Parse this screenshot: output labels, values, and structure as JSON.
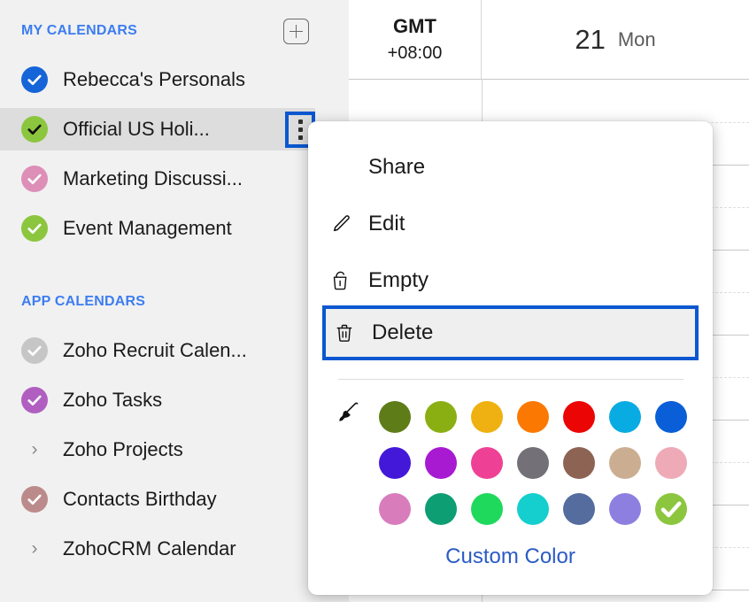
{
  "sidebar": {
    "sections": [
      {
        "title": "MY CALENDARS",
        "add_button": "+",
        "items": [
          {
            "label": "Rebecca's Personals",
            "color": "#1565d8",
            "checked": true,
            "type": "check"
          },
          {
            "label": "Official US Holi...",
            "color": "#8cc63e",
            "checked": true,
            "type": "check",
            "selected": true,
            "dark_check": true
          },
          {
            "label": "Marketing Discussi...",
            "color": "#dd8fb8",
            "checked": true,
            "type": "check"
          },
          {
            "label": "Event Management",
            "color": "#8cc63e",
            "checked": true,
            "type": "check"
          }
        ]
      },
      {
        "title": "APP CALENDARS",
        "items": [
          {
            "label": "Zoho Recruit Calen...",
            "color": "#c6c6c6",
            "checked": true,
            "type": "check"
          },
          {
            "label": "Zoho Tasks",
            "color": "#b05fc0",
            "checked": true,
            "type": "check"
          },
          {
            "label": "Zoho Projects",
            "type": "chevron",
            "chevron": "›"
          },
          {
            "label": "Contacts Birthday",
            "color": "#bb8b8b",
            "checked": true,
            "type": "check"
          },
          {
            "label": "ZohoCRM Calendar",
            "type": "chevron",
            "chevron": "›"
          }
        ]
      }
    ]
  },
  "calendar": {
    "timezone_name": "GMT",
    "timezone_offset": "+08:00",
    "day_number": "21",
    "day_name": "Mon"
  },
  "popup": {
    "menu": [
      {
        "label": "Share",
        "icon": "none"
      },
      {
        "label": "Edit",
        "icon": "pencil-icon"
      },
      {
        "label": "Empty",
        "icon": "trash-open-icon"
      },
      {
        "label": "Delete",
        "icon": "trash-icon",
        "highlighted": true
      }
    ],
    "palette_icon": "paintbrush-icon",
    "colors": [
      [
        "#5e7d18",
        "#8aaf12",
        "#eeb111",
        "#fb7902",
        "#ec0505",
        "#09ace2",
        "#0a5fd8"
      ],
      [
        "#4318d9",
        "#a81ad2",
        "#ee4195",
        "#737077",
        "#8d6353",
        "#cbae92",
        "#eeaab6"
      ],
      [
        "#d87cbc",
        "#0d9e73",
        "#1fd95d",
        "#15cece",
        "#546c9e",
        "#8c7fe0",
        "#8cc63e"
      ]
    ],
    "selected_color": "#8cc63e",
    "selected_index": {
      "row": 2,
      "col": 6
    },
    "custom_color_label": "Custom Color"
  }
}
